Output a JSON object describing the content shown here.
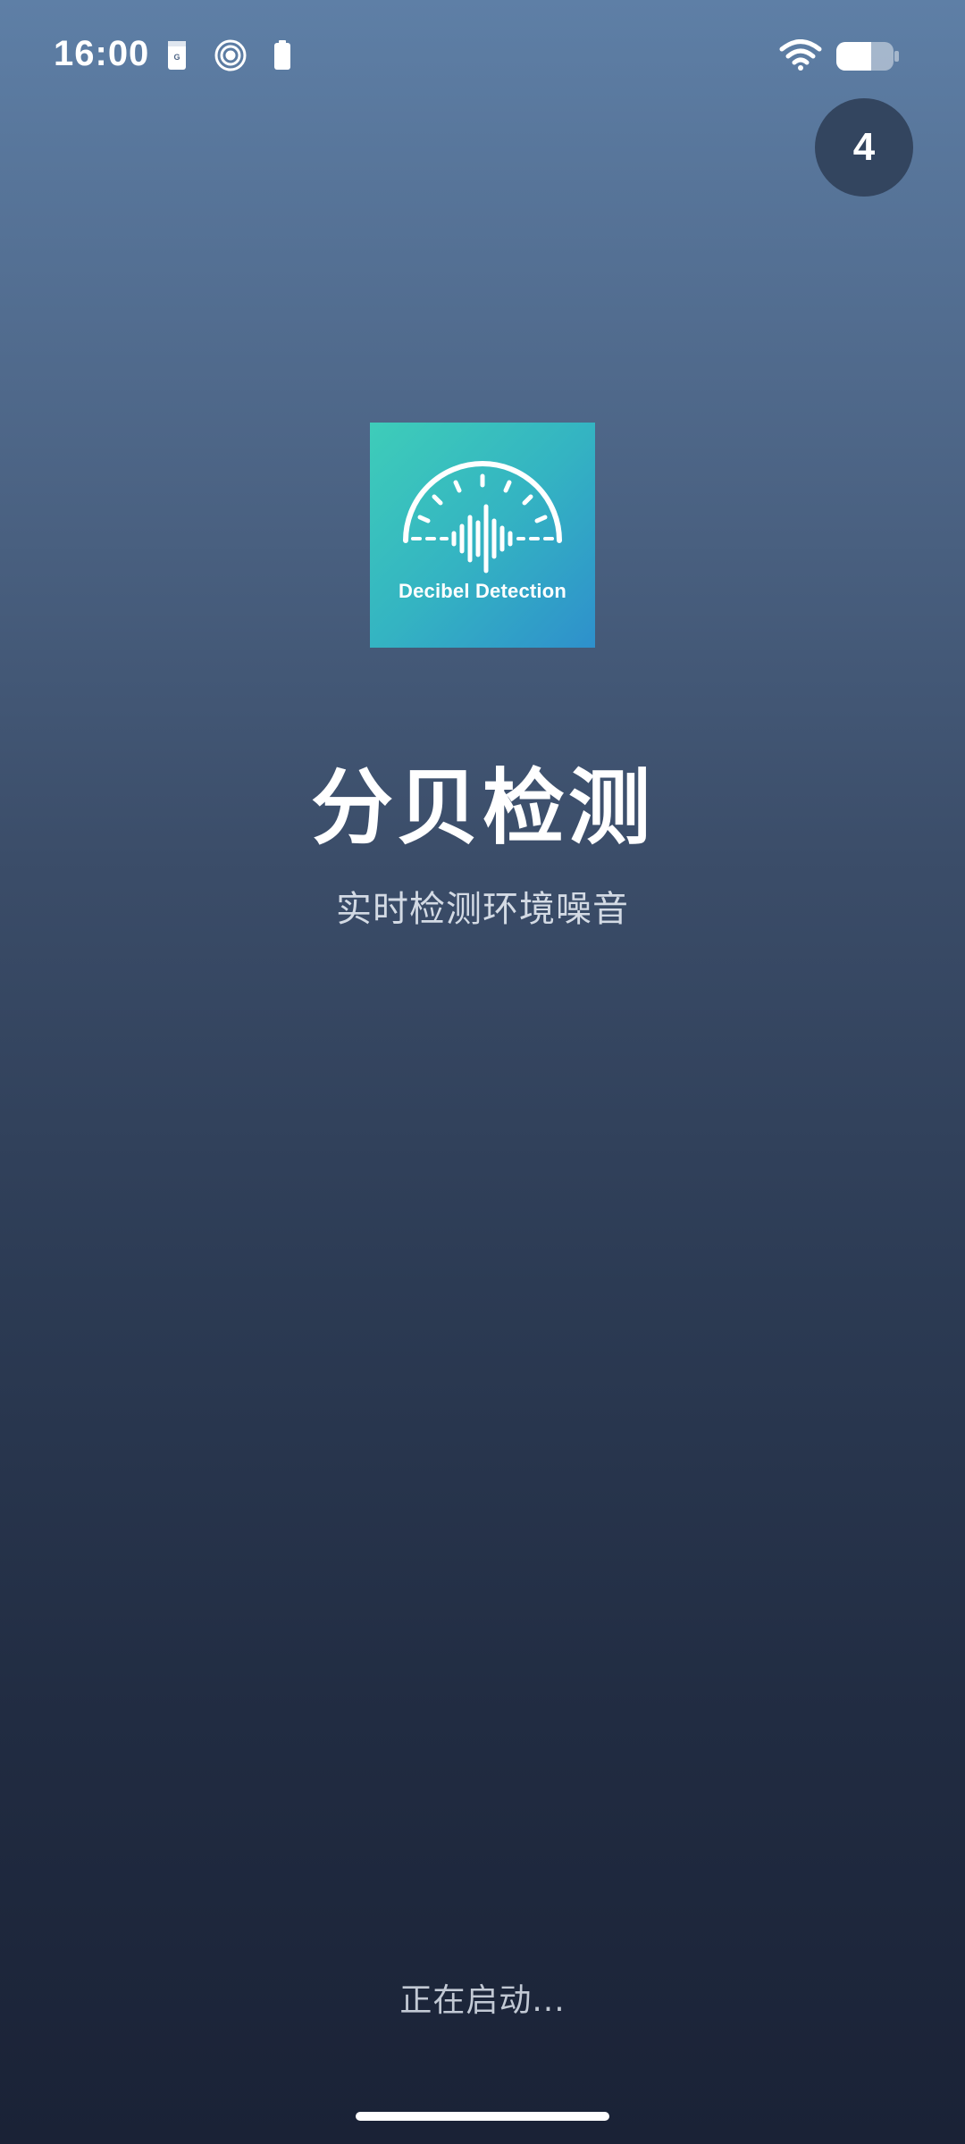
{
  "status_bar": {
    "time": "16:00",
    "icons": [
      "sim-icon",
      "spiral-icon",
      "battery-small-icon",
      "wifi-icon",
      "battery-icon"
    ]
  },
  "countdown": {
    "value": "4"
  },
  "logo": {
    "text": "Decibel Detection",
    "colors": [
      "#3ecdb9",
      "#2e90cc"
    ]
  },
  "app": {
    "title": "分贝检测",
    "subtitle": "实时检测环境噪音"
  },
  "loading": {
    "text": "正在启动..."
  }
}
